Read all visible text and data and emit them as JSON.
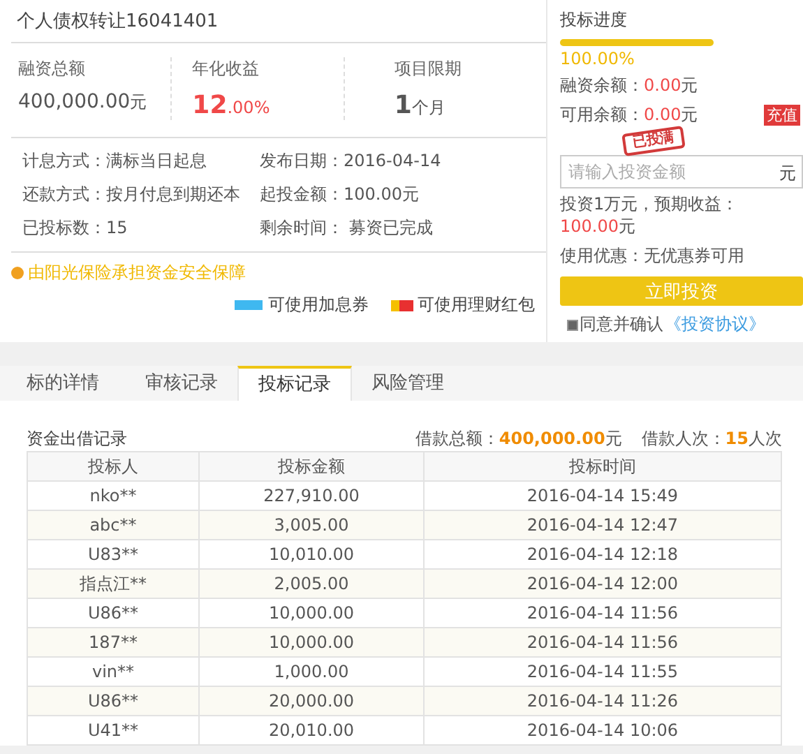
{
  "title": "个人债权转让16041401",
  "stats": [
    {
      "label": "融资总额",
      "value": "400,000.00",
      "unit": "元",
      "kind": "plain"
    },
    {
      "label": "年化收益",
      "value": "12",
      "unit": ".00%",
      "kind": "rate"
    },
    {
      "label": "项目限期",
      "value": "1",
      "unit": "个月",
      "kind": "term"
    }
  ],
  "details": [
    {
      "label": "计息方式：",
      "value": "满标当日起息"
    },
    {
      "label": "发布日期：",
      "value": "2016-04-14"
    },
    {
      "label": "还款方式：",
      "value": "按月付息到期还本"
    },
    {
      "label": "起投金额：",
      "value": "100.00元"
    },
    {
      "label": "已投标数：",
      "value": "15"
    },
    {
      "label": "剩余时间：",
      "value": " 募资已完成"
    }
  ],
  "guarantee": "由阳光保险承担资金安全保障",
  "perks": [
    {
      "label": "可使用加息券",
      "kind": "coupon"
    },
    {
      "label": "可使用理财红包",
      "kind": "redpacket"
    }
  ],
  "invest": {
    "title": "投标进度",
    "progress": {
      "level": 1,
      "reading": "100.00%"
    },
    "balances": [
      {
        "label": "融资余额：",
        "value": "0.00",
        "unit": "元"
      },
      {
        "label": "可用余额：",
        "value": "0.00",
        "unit": "元"
      }
    ],
    "recharge": "充值",
    "amount": {
      "placeholder": "请输入投资金额",
      "unit": "元"
    },
    "stamp": "已投满",
    "estimate": {
      "text": "投资1万元，预期收益：",
      "value": "100.00",
      "unit": "元"
    },
    "discount": {
      "label": "使用优惠：",
      "value": "无优惠券可用"
    },
    "submit": "立即投资",
    "agree": {
      "checked": true,
      "label": "同意并确认",
      "link": "《投资协议》"
    }
  },
  "tabs": [
    {
      "label": "标的详情",
      "selected": false
    },
    {
      "label": "审核记录",
      "selected": false
    },
    {
      "label": "投标记录",
      "selected": true
    },
    {
      "label": "风险管理",
      "selected": false
    }
  ],
  "records": {
    "title": "资金出借记录",
    "summary": [
      {
        "label": "借款总额：",
        "value": "400,000.00",
        "unit": "元"
      },
      {
        "label": "借款人次：",
        "value": "15",
        "unit": "人次"
      }
    ],
    "columns": [
      "投标人",
      "投标金额",
      "投标时间"
    ],
    "rows": [
      [
        "nko**",
        "227,910.00",
        "2016-04-14 15:49"
      ],
      [
        "abc**",
        "3,005.00",
        "2016-04-14 12:47"
      ],
      [
        "U83**",
        "10,010.00",
        "2016-04-14 12:18"
      ],
      [
        "指点江**",
        "2,005.00",
        "2016-04-14 12:00"
      ],
      [
        "U86**",
        "10,000.00",
        "2016-04-14 11:56"
      ],
      [
        "187**",
        "10,000.00",
        "2016-04-14 11:56"
      ],
      [
        "vin**",
        "1,000.00",
        "2016-04-14 11:55"
      ],
      [
        "U86**",
        "20,000.00",
        "2016-04-14 11:26"
      ],
      [
        "U41**",
        "20,010.00",
        "2016-04-14 10:06"
      ]
    ]
  }
}
